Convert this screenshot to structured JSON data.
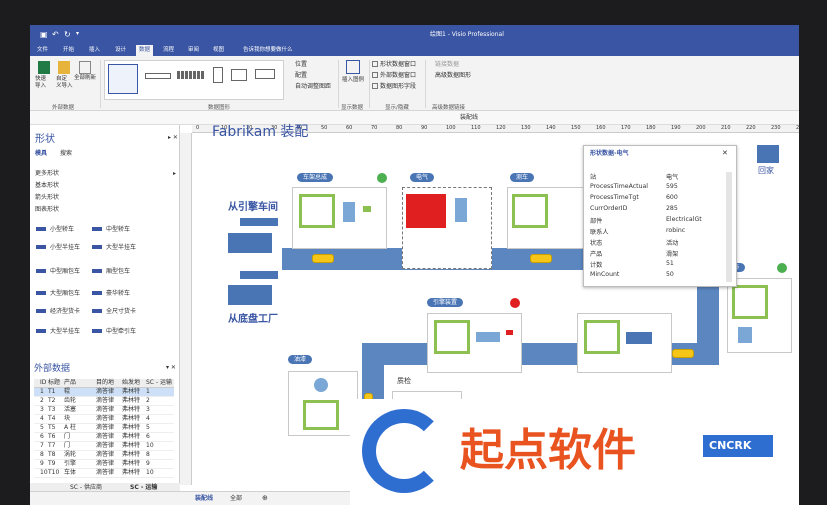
{
  "app": {
    "title": "绘图1 - Visio Professional"
  },
  "tabs": [
    "文件",
    "开始",
    "插入",
    "设计",
    "数据",
    "流程",
    "审阅",
    "视图"
  ],
  "tell_me": "告诉我你想要做什么",
  "ribbon": {
    "quick_import": "快速\n导入",
    "custom_import": "自定\n义导入",
    "refresh_all": "全部刷新",
    "group_external": "外部数据",
    "group_graphics": "数据图形",
    "position": "位置",
    "config": "配置",
    "auto_adjust": "自动调整图距",
    "insert_legend": "插入图例",
    "group_show": "显示数据",
    "shape_data_window": "形状数据窗口",
    "external_data_window": "外部数据窗口",
    "data_graphic_fields": "数据图形字段",
    "group_showhide": "显示/隐藏",
    "link_data": "链接数据",
    "advanced_linking": "高级数据图形",
    "group_advanced": "高级数据链接",
    "more_label": "装配线"
  },
  "shapes_panel": {
    "title": "形状",
    "tab_stencils": "模具",
    "tab_search": "搜索",
    "items": [
      "更多形状",
      "基本形状",
      "箭头形状",
      "图表形状"
    ],
    "stencils": [
      [
        "小型轿车",
        "中型轿车"
      ],
      [
        "小型半挂车",
        "大型半挂车"
      ],
      [
        "中型厢包车",
        "厢型包车"
      ],
      [
        "大型厢包车",
        "豪华轿车"
      ],
      [
        "经济型货卡",
        "全尺寸货卡"
      ],
      [
        "大型半挂车",
        "中型牵引车"
      ]
    ]
  },
  "external_data": {
    "title": "外部数据",
    "headers": [
      "ID",
      "标题",
      "产品",
      "目的地",
      "始发地",
      "SC - 运输"
    ],
    "rows": [
      [
        "1",
        "T1",
        "辊",
        "滴答律",
        "弗林特",
        "1"
      ],
      [
        "2",
        "T2",
        "齿轮",
        "滴答律",
        "弗林特",
        "2"
      ],
      [
        "3",
        "T3",
        "活塞",
        "滴答律",
        "弗林特",
        "3"
      ],
      [
        "4",
        "T4",
        "块",
        "滴答律",
        "弗林特",
        "4"
      ],
      [
        "5",
        "T5",
        "A 柱",
        "滴答律",
        "弗林特",
        "5"
      ],
      [
        "6",
        "T6",
        "门",
        "滴答律",
        "弗林特",
        "6"
      ],
      [
        "7",
        "T7",
        "门",
        "滴答律",
        "弗林特",
        "10"
      ],
      [
        "8",
        "T8",
        "涡轮",
        "滴答律",
        "弗林特",
        "8"
      ],
      [
        "9",
        "T9",
        "引擎",
        "滴答律",
        "弗林特",
        "9"
      ],
      [
        "10",
        "T10",
        "车体",
        "滴答律",
        "弗林特",
        "10"
      ]
    ],
    "bottom_tabs": [
      "SC - 供应商",
      "SC - 运输"
    ]
  },
  "canvas": {
    "heading": "Fabrikam 装配",
    "labels": [
      "车架总成",
      "电气",
      "测车",
      "引擎装置",
      "油漆",
      "质检",
      "饰"
    ],
    "from_workshop": "从引擎车间",
    "from_chassis": "从底盘工厂",
    "home": "回家",
    "legend": "图例"
  },
  "data_window": {
    "title": "形状数据-电气",
    "rows": [
      [
        "站",
        "电气"
      ],
      [
        "ProcessTimeActual",
        "595"
      ],
      [
        "ProcessTimeTgt",
        "600"
      ],
      [
        "CurrOrderID",
        "285"
      ],
      [
        "部件",
        "ElectricalGt"
      ],
      [
        "联系人",
        "robinc"
      ],
      [
        "状态",
        "活动"
      ],
      [
        "产品",
        "滑架"
      ],
      [
        "计数",
        "51"
      ],
      [
        "MinCount",
        "50"
      ]
    ]
  },
  "status": {
    "page_tab": "装配线",
    "all": "全部"
  },
  "watermark": {
    "text": "起点软件",
    "site1": "CNCRK",
    ".com": ".COM"
  },
  "colors": {
    "accent": "#3955a3",
    "green": "#8cc152",
    "red": "#e02020",
    "conveyor": "#5b86c0"
  }
}
